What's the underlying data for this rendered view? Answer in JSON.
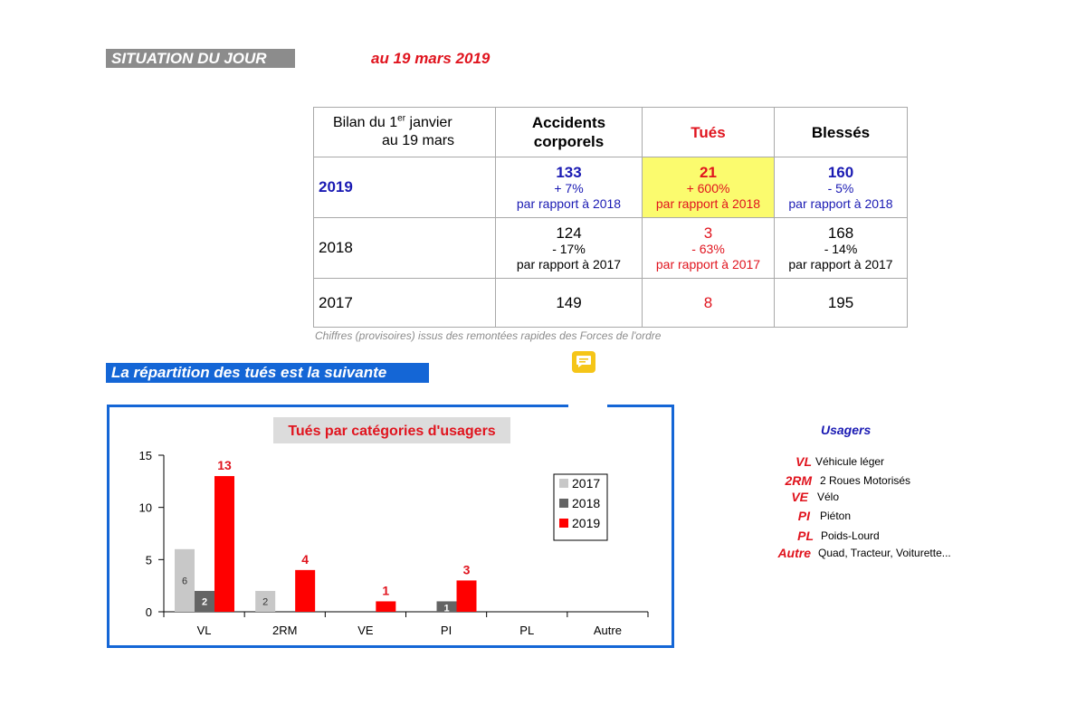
{
  "header": {
    "situation_label": "SITUATION DU JOUR",
    "date_label": "au 19 mars 2019"
  },
  "table": {
    "bilan_line1": "Bilan du 1",
    "bilan_sup": "er",
    "bilan_line1_end": " janvier",
    "bilan_line2": "au 19 mars",
    "col_accidents_l1": "Accidents",
    "col_accidents_l2": "corporels",
    "col_tues": "Tués",
    "col_blesses": "Blessés",
    "rows": [
      {
        "year": "2019",
        "accidents": {
          "value": "133",
          "pct": "+ 7%",
          "ref": "par rapport à 2018"
        },
        "tues": {
          "value": "21",
          "pct": "+ 600%",
          "ref": "par rapport à 2018"
        },
        "blesses": {
          "value": "160",
          "pct": "- 5%",
          "ref": "par rapport à 2018"
        }
      },
      {
        "year": "2018",
        "accidents": {
          "value": "124",
          "pct": "- 17%",
          "ref": "par rapport à 2017"
        },
        "tues": {
          "value": "3",
          "pct": "- 63%",
          "ref": "par rapport à 2017"
        },
        "blesses": {
          "value": "168",
          "pct": "- 14%",
          "ref": "par rapport à 2017"
        }
      },
      {
        "year": "2017",
        "accidents": {
          "value": "149"
        },
        "tues": {
          "value": "8"
        },
        "blesses": {
          "value": "195"
        }
      }
    ],
    "footnote": "Chiffres (provisoires) issus des remontées rapides des Forces de l'ordre"
  },
  "section": {
    "repartition_title": "La répartition des tués est la suivante",
    "comment_icon": "comment-icon"
  },
  "chart_data": {
    "type": "bar",
    "title": "Tués par catégories d'usagers",
    "categories": [
      "VL",
      "2RM",
      "VE",
      "PI",
      "PL",
      "Autre"
    ],
    "series": [
      {
        "name": "2017",
        "values": [
          6,
          2,
          0,
          0,
          0,
          0
        ],
        "color": "#c8c8c8"
      },
      {
        "name": "2018",
        "values": [
          2,
          0,
          0,
          1,
          0,
          0
        ],
        "color": "#646464"
      },
      {
        "name": "2019",
        "values": [
          13,
          4,
          1,
          3,
          0,
          0
        ],
        "color": "#ff0000"
      }
    ],
    "ylim": [
      0,
      15
    ],
    "yticks": [
      0,
      5,
      10,
      15
    ],
    "legend": "top-right",
    "grid": false,
    "title_color": "#e0141e",
    "title_bg": "#dcdcdc"
  },
  "usagers": {
    "title": "Usagers",
    "items": [
      {
        "code": "VL",
        "desc": "Véhicule léger"
      },
      {
        "code": "2RM",
        "desc": "2 Roues Motorisés"
      },
      {
        "code": "VE",
        "desc": "Vélo"
      },
      {
        "code": "PI",
        "desc": "Piéton"
      },
      {
        "code": "PL",
        "desc": "Poids-Lourd"
      },
      {
        "code": "Autre",
        "desc": "Quad, Tracteur, Voiturette..."
      }
    ]
  },
  "colors": {
    "accent_blue": "#1466d6",
    "text_blue": "#1a1ab3",
    "accent_red": "#e0141e",
    "highlight_yellow": "#fbfb6e",
    "label_grey": "#8c8c8c"
  }
}
